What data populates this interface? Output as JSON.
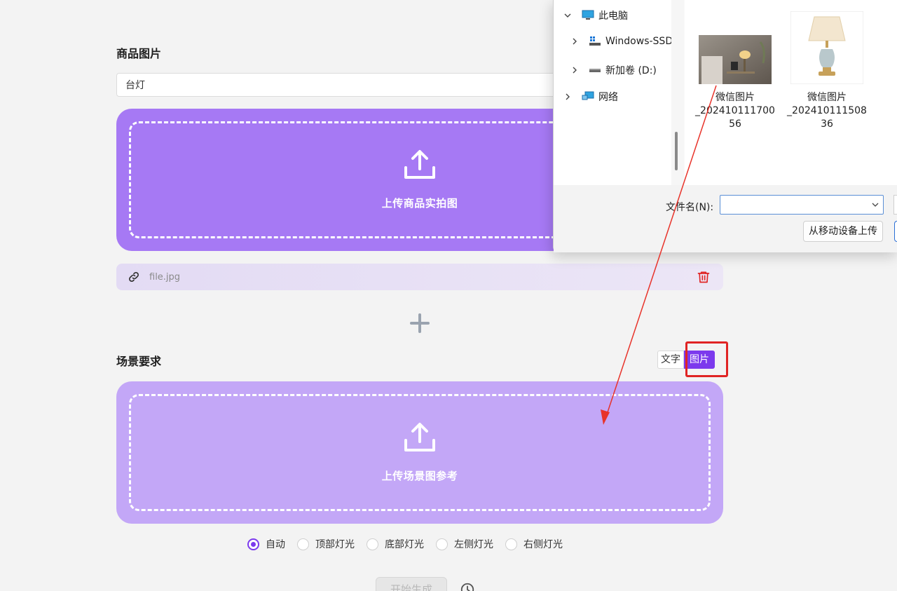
{
  "product": {
    "title": "商品图片",
    "input_value": "台灯",
    "upload_label": "上传商品实拍图",
    "file_name": "file.jpg"
  },
  "scene": {
    "title": "场景要求",
    "mode_text": "文字",
    "mode_image": "图片",
    "upload_label": "上传场景图参考"
  },
  "lighting": {
    "options": [
      "自动",
      "顶部灯光",
      "底部灯光",
      "左侧灯光",
      "右侧灯光"
    ],
    "selected": "自动"
  },
  "actions": {
    "start_label": "开始生成"
  },
  "dialog": {
    "nav": {
      "this_pc": "此电脑",
      "windows_ssd": "Windows-SSD",
      "new_volume": "新加卷 (D:)",
      "network": "网络"
    },
    "files": [
      {
        "line1": "微信图片",
        "line2": "_202410111700",
        "line3": "56"
      },
      {
        "line1": "微信图片",
        "line2": "_202410111508",
        "line3": "36"
      }
    ],
    "filename_label": "文件名(N):",
    "filename_value": "",
    "mobile_upload_label": "从移动设备上传"
  },
  "colors": {
    "accent": "#7c3aed",
    "upload_product_bg": "#a679f4",
    "upload_scene_bg": "#c3a7f7",
    "annotation": "#e02424",
    "delete": "#e02424"
  },
  "icons": {
    "upload": "upload-icon",
    "link": "link-icon",
    "delete": "trash-icon",
    "add": "plus-icon",
    "history": "history-icon"
  }
}
